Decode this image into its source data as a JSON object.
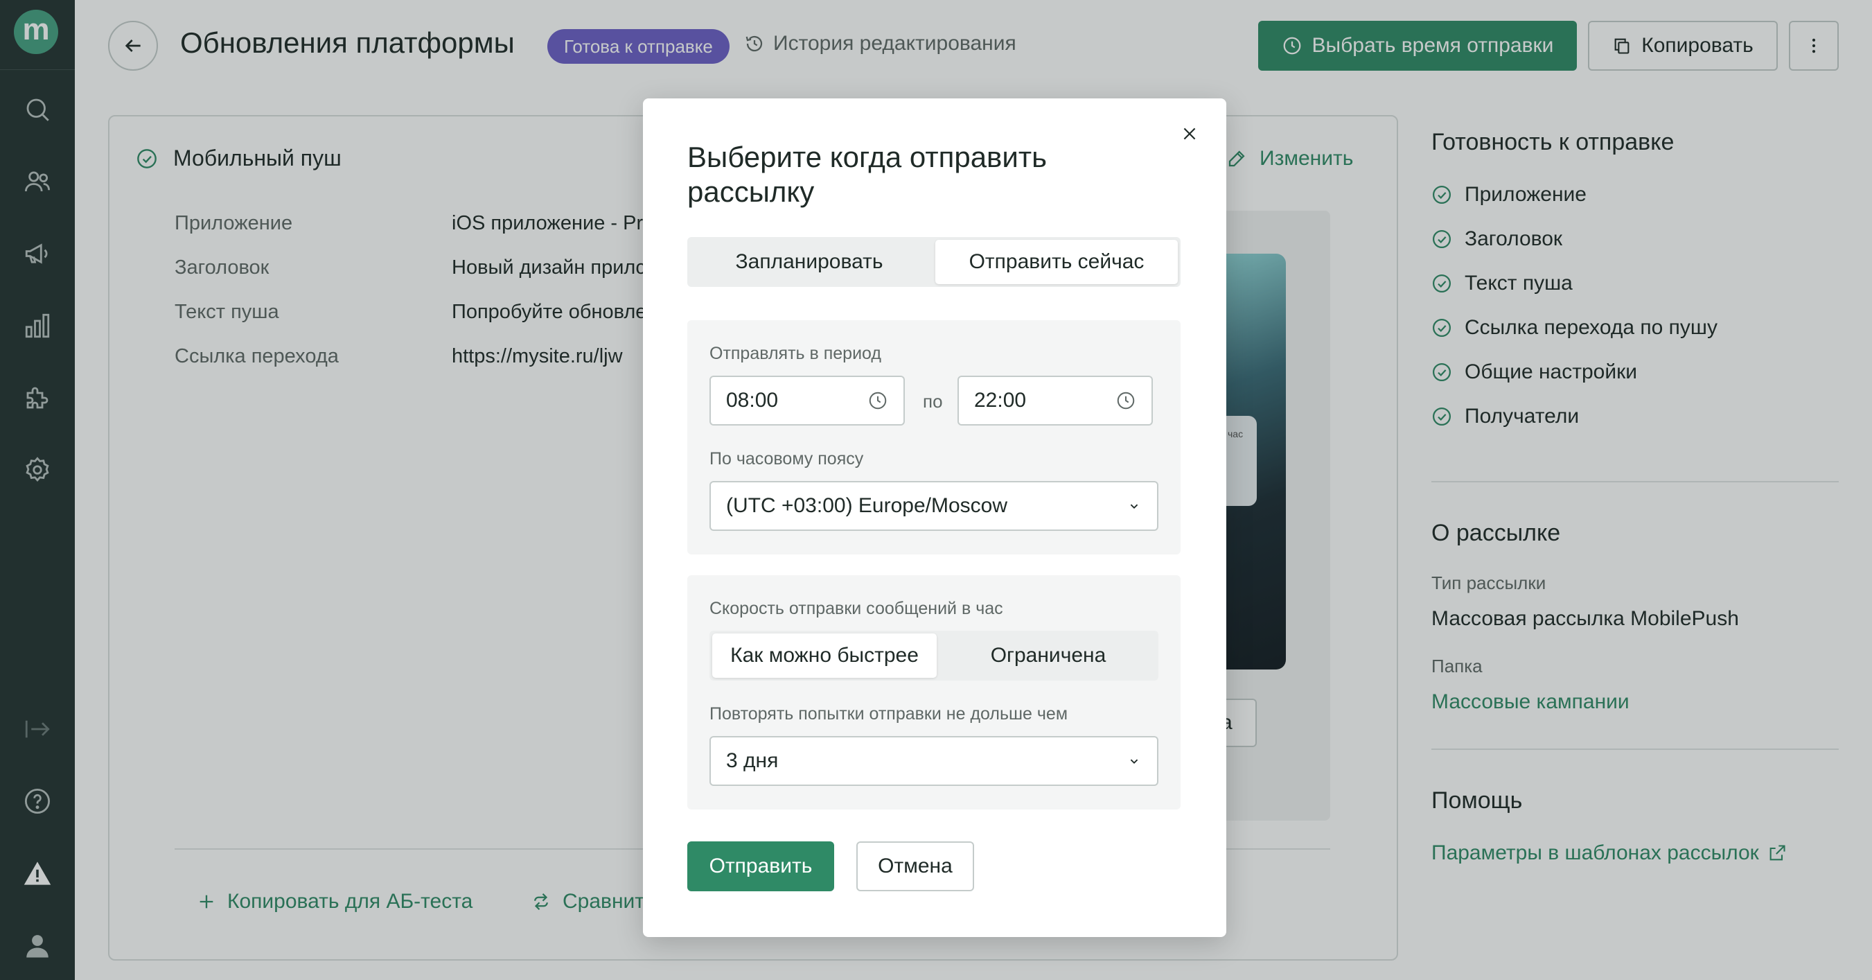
{
  "app": {
    "logo_letter": "m"
  },
  "sidebar": {
    "items": [
      {
        "icon": "search-icon"
      },
      {
        "icon": "users-icon"
      },
      {
        "icon": "megaphone-icon"
      },
      {
        "icon": "bar-chart-icon"
      },
      {
        "icon": "puzzle-icon"
      },
      {
        "icon": "gear-icon"
      },
      {
        "icon": "logout-icon"
      },
      {
        "icon": "help-icon"
      },
      {
        "icon": "warning-icon"
      },
      {
        "icon": "user-icon"
      }
    ]
  },
  "header": {
    "title": "Обновления платформы",
    "status_badge": "Готова к отправке",
    "history_link": "История редактирования",
    "schedule_button": "Выбрать время отправки",
    "copy_button": "Копировать"
  },
  "card": {
    "title": "Мобильный пуш",
    "edit_link": "Изменить",
    "fields": [
      {
        "label": "Приложение",
        "value": "iOS приложение - Pr"
      },
      {
        "label": "Заголовок",
        "value": "Новый дизайн прилс"
      },
      {
        "label": "Текст пуша",
        "value": "Попробуйте обновле"
      },
      {
        "label": "Ссылка перехода",
        "value": "https://mysite.ru/ljw"
      }
    ],
    "preview_notif_text": "час",
    "preview_button_fragment": "а",
    "ab_test_link": "Копировать для АБ-теста",
    "compare_link": "Сравнит"
  },
  "right": {
    "readiness_title": "Готовность к отправке",
    "checklist": [
      "Приложение",
      "Заголовок",
      "Текст пуша",
      "Ссылка перехода по пушу",
      "Общие настройки",
      "Получатели"
    ],
    "about_title": "О рассылке",
    "type_label": "Тип рассылки",
    "type_value": "Массовая рассылка MobilePush",
    "folder_label": "Папка",
    "folder_value": "Массовые кампании",
    "help_title": "Помощь",
    "help_link": "Параметры в шаблонах рассылок"
  },
  "modal": {
    "title": "Выберите когда отправить рассылку",
    "tabs": [
      {
        "label": "Запланировать",
        "active": false
      },
      {
        "label": "Отправить сейчас",
        "active": true
      }
    ],
    "period_label": "Отправлять в период",
    "time_from": "08:00",
    "between": "по",
    "time_to": "22:00",
    "timezone_label": "По часовому поясу",
    "timezone_value": "(UTC +03:00) Europe/Moscow",
    "speed_label": "Скорость отправки сообщений в час",
    "speed_options": [
      {
        "label": "Как можно быстрее",
        "active": true
      },
      {
        "label": "Ограничена",
        "active": false
      }
    ],
    "retry_label": "Повторять попытки отправки не дольше чем",
    "retry_value": "3 дня",
    "send_button": "Отправить",
    "cancel_button": "Отмена"
  },
  "colors": {
    "accent": "#2f8a66",
    "badge": "#6c5fc7",
    "sidebar": "#243332"
  }
}
